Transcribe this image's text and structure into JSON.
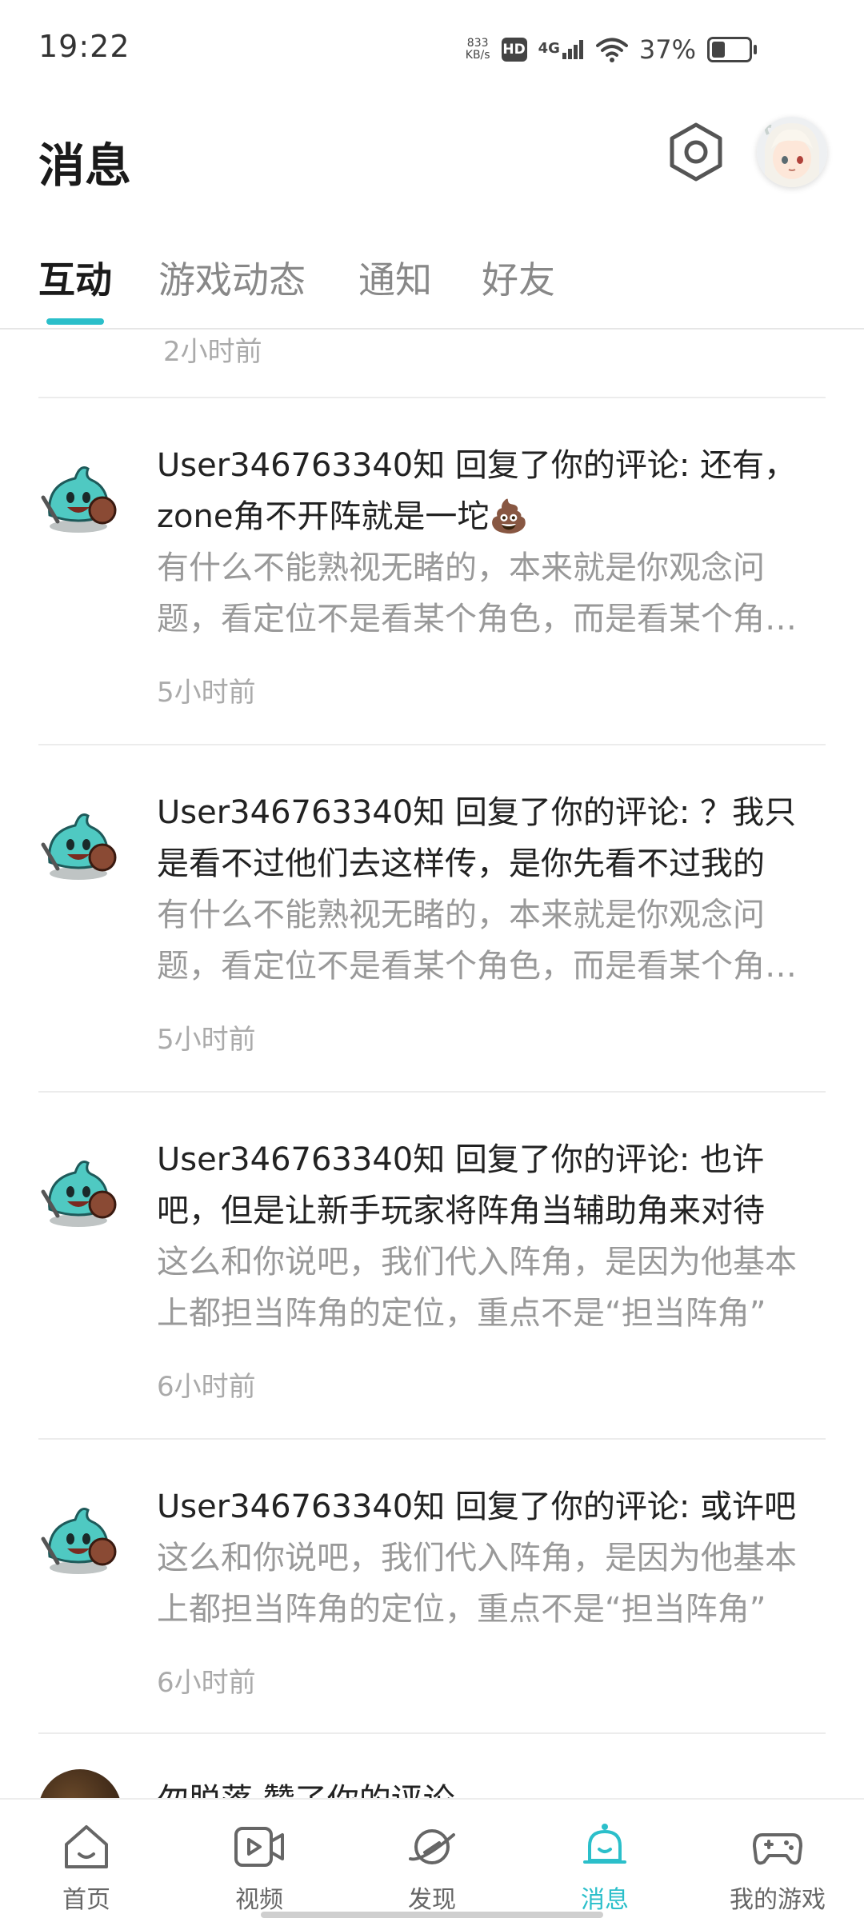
{
  "status_bar": {
    "time": "19:22",
    "net_speed_value": "833",
    "net_speed_unit": "KB/s",
    "hd_label": "HD",
    "network": "4G",
    "battery_percent_text": "37%",
    "battery_level": 0.37
  },
  "header": {
    "title": "消息"
  },
  "tabs": [
    {
      "label": "互动",
      "active": true
    },
    {
      "label": "游戏动态",
      "active": false
    },
    {
      "label": "通知",
      "active": false
    },
    {
      "label": "好友",
      "active": false
    }
  ],
  "list": {
    "partial_top_time": "2小时前",
    "items": [
      {
        "title": "User346763340知 回复了你的评论: 还有，zone角不开阵就是一坨💩",
        "quote": "有什么不能熟视无睹的，本来就是你观念问题，看定位不是看某个角色，而是看某个角色的具体定位",
        "time": "5小时前"
      },
      {
        "title": "User346763340知 回复了你的评论: ？我只是看不过他们去这样传，是你先看不过我的",
        "quote": "有什么不能熟视无睹的，本来就是你观念问题，看定位不是看某个角色，而是看某个角色的具体定位",
        "time": "5小时前"
      },
      {
        "title": "User346763340知 回复了你的评论: 也许吧，但是让新手玩家将阵角当辅助角来对待",
        "quote": "这么和你说吧，我们代入阵角，是因为他基本上都担当阵角的定位，重点不是“担当阵角”",
        "time": "6小时前"
      },
      {
        "title": "User346763340知 回复了你的评论: 或许吧",
        "quote": "这么和你说吧，我们代入阵角，是因为他基本上都担当阵角的定位，重点不是“担当阵角”",
        "time": "6小时前"
      }
    ],
    "partial_bottom_title": "勿脱落 赞了你的评论"
  },
  "bottom_nav": [
    {
      "label": "首页",
      "icon": "home-icon",
      "active": false
    },
    {
      "label": "视频",
      "icon": "video-icon",
      "active": false
    },
    {
      "label": "发现",
      "icon": "discover-planet-icon",
      "active": false
    },
    {
      "label": "消息",
      "icon": "bell-icon",
      "active": true
    },
    {
      "label": "我的游戏",
      "icon": "gamepad-icon",
      "active": false
    }
  ],
  "colors": {
    "accent": "#2bbfca",
    "text_primary": "#222222",
    "text_secondary": "#999999",
    "text_time": "#aaaaaa"
  }
}
